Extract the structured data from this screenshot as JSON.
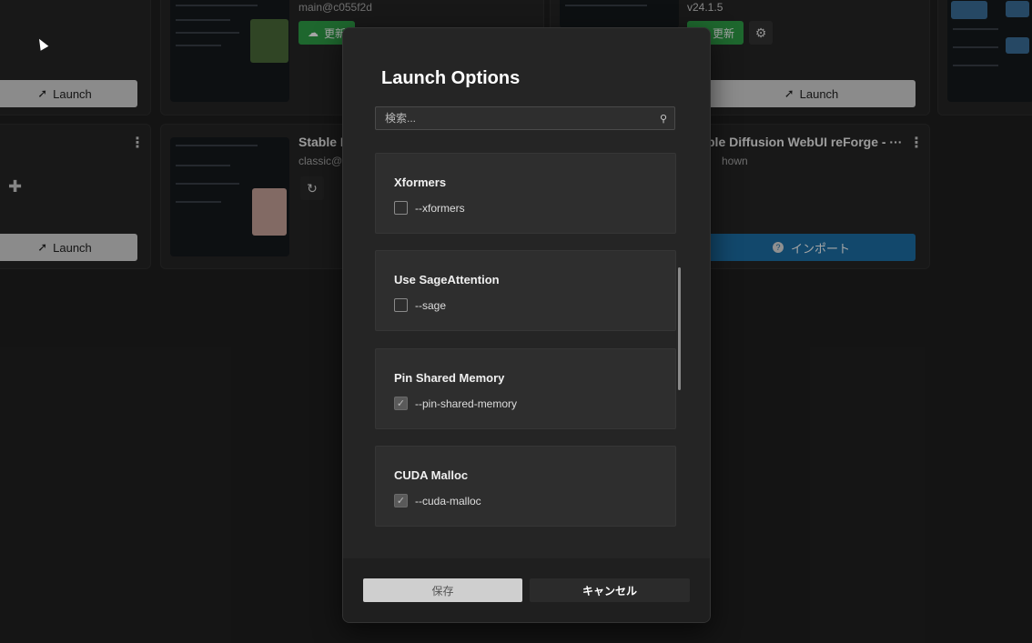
{
  "background_cards": {
    "card1": {
      "launch_label": "Launch"
    },
    "card2": {
      "sub": "main@c055f2d",
      "update_label": "更新"
    },
    "card3": {
      "sub": "v24.1.5",
      "update_label": "更新",
      "launch_label": "Launch"
    },
    "card4": {
      "launch_label": "Launch"
    },
    "card5": {
      "title": "Stable D",
      "sub": "classic@c"
    },
    "card6": {
      "title": "ble Diffusion WebUI reForge - ···",
      "sub": "hown",
      "import_label": "インポート"
    }
  },
  "modal": {
    "title": "Launch Options",
    "search_placeholder": "検索...",
    "options": [
      {
        "title": "Xformers",
        "flag": "--xformers",
        "checked": false
      },
      {
        "title": "Use SageAttention",
        "flag": "--sage",
        "checked": false
      },
      {
        "title": "Pin Shared Memory",
        "flag": "--pin-shared-memory",
        "checked": true
      },
      {
        "title": "CUDA Malloc",
        "flag": "--cuda-malloc",
        "checked": true
      }
    ],
    "save_label": "保存",
    "cancel_label": "キャンセル"
  }
}
